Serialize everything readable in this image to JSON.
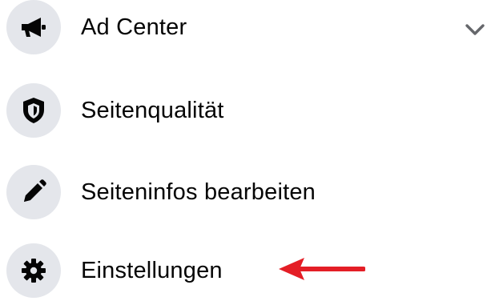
{
  "menu": {
    "items": [
      {
        "label": "Ad Center",
        "icon": "megaphone-icon",
        "expandable": true
      },
      {
        "label": "Seitenqualität",
        "icon": "shield-icon"
      },
      {
        "label": "Seiteninfos bearbeiten",
        "icon": "pencil-icon"
      },
      {
        "label": "Einstellungen",
        "icon": "gear-icon",
        "highlighted_by": "red-arrow-icon"
      }
    ]
  },
  "colors": {
    "icon_background": "#e4e6eb",
    "icon_foreground": "#050505",
    "text": "#050505",
    "chevron": "#65676b",
    "annotation_arrow": "#e41e26"
  }
}
